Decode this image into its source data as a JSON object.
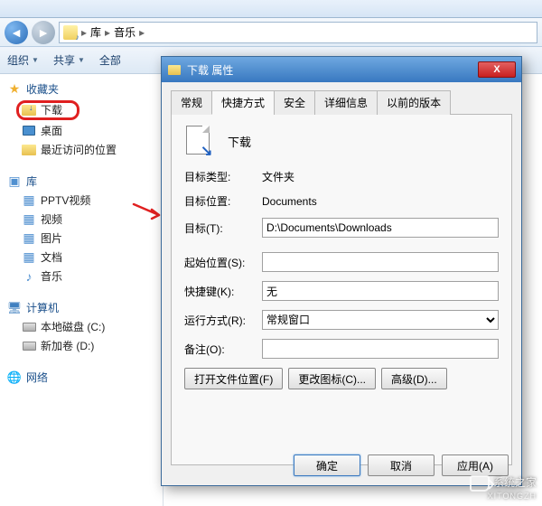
{
  "breadcrumb": {
    "root": "库",
    "current": "音乐"
  },
  "toolbar": {
    "organize": "组织",
    "share": "共享",
    "all": "全部"
  },
  "sidebar": {
    "favorites": {
      "head": "收藏夹",
      "downloads": "下载",
      "desktop": "桌面",
      "recent": "最近访问的位置"
    },
    "libraries": {
      "head": "库",
      "pptv": "PPTV视频",
      "videos": "视频",
      "pictures": "图片",
      "documents": "文档",
      "music": "音乐"
    },
    "computer": {
      "head": "计算机",
      "drive_c": "本地磁盘 (C:)",
      "drive_d": "新加卷 (D:)"
    },
    "network": {
      "head": "网络"
    }
  },
  "dialog": {
    "title": "下载 属性",
    "tabs": {
      "general": "常规",
      "shortcut": "快捷方式",
      "security": "安全",
      "details": "详细信息",
      "previous": "以前的版本"
    },
    "header_name": "下载",
    "target_type_label": "目标类型:",
    "target_type_value": "文件夹",
    "target_loc_label": "目标位置:",
    "target_loc_value": "Documents",
    "target_label": "目标(T):",
    "target_value": "D:\\Documents\\Downloads",
    "start_label": "起始位置(S):",
    "start_value": "",
    "hotkey_label": "快捷键(K):",
    "hotkey_value": "无",
    "run_label": "运行方式(R):",
    "run_value": "常规窗口",
    "comment_label": "备注(O):",
    "comment_value": "",
    "open_loc": "打开文件位置(F)",
    "change_icon": "更改图标(C)...",
    "advanced": "高级(D)...",
    "ok": "确定",
    "cancel": "取消",
    "apply": "应用(A)"
  },
  "watermark": {
    "line1": "系统之家",
    "line2": "XITONGZH"
  }
}
